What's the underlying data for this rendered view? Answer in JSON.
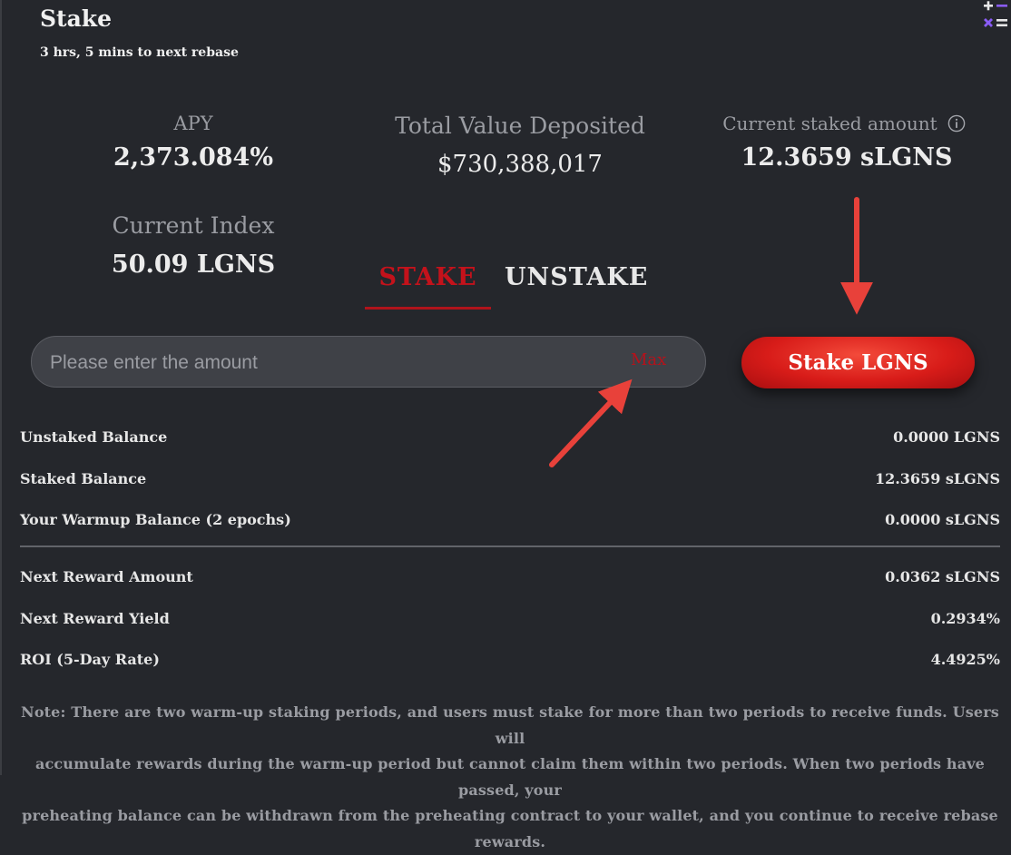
{
  "header": {
    "title": "Stake",
    "rebase_text": "3 hrs, 5 mins to next rebase"
  },
  "stats": {
    "apy_label": "APY",
    "apy_value": "2,373.084%",
    "tvd_label": "Total Value Deposited",
    "tvd_value": "$730,388,017",
    "current_staked_label": "Current staked amount",
    "current_staked_value": "12.3659 sLGNS",
    "current_index_label": "Current Index",
    "current_index_value": "50.09 LGNS"
  },
  "tabs": {
    "stake_label": "STAKE",
    "unstake_label": "UNSTAKE",
    "active": "stake"
  },
  "input": {
    "value": "",
    "placeholder": "Please enter the amount",
    "max_label": "Max"
  },
  "action": {
    "stake_button_label": "Stake LGNS"
  },
  "balances": [
    {
      "label": "Unstaked Balance",
      "value": "0.0000 LGNS"
    },
    {
      "label": "Staked Balance",
      "value": "12.3659 sLGNS"
    },
    {
      "label": "Your Warmup Balance (2 epochs)",
      "value": "0.0000 sLGNS"
    }
  ],
  "rewards": [
    {
      "label": "Next Reward Amount",
      "value": "0.0362 sLGNS"
    },
    {
      "label": "Next Reward Yield",
      "value": "0.2934%"
    },
    {
      "label": "ROI (5-Day Rate)",
      "value": "4.4925%"
    }
  ],
  "note": {
    "line1": "Note: There are two warm-up staking periods, and users must stake for more than two periods to receive funds. Users will",
    "line2": "accumulate rewards during the warm-up period but cannot claim them within two periods. When two periods have passed, your",
    "line3": "preheating balance can be withdrawn from the preheating contract to your wallet, and you continue to receive rebase rewards."
  },
  "colors": {
    "background": "#25272c",
    "accent_red": "#c4121b",
    "button_red": "#d81c19",
    "calculator_purple": "#8a5cf6"
  },
  "icons": {
    "calculator": "calculator-icon",
    "info": "info-icon"
  }
}
